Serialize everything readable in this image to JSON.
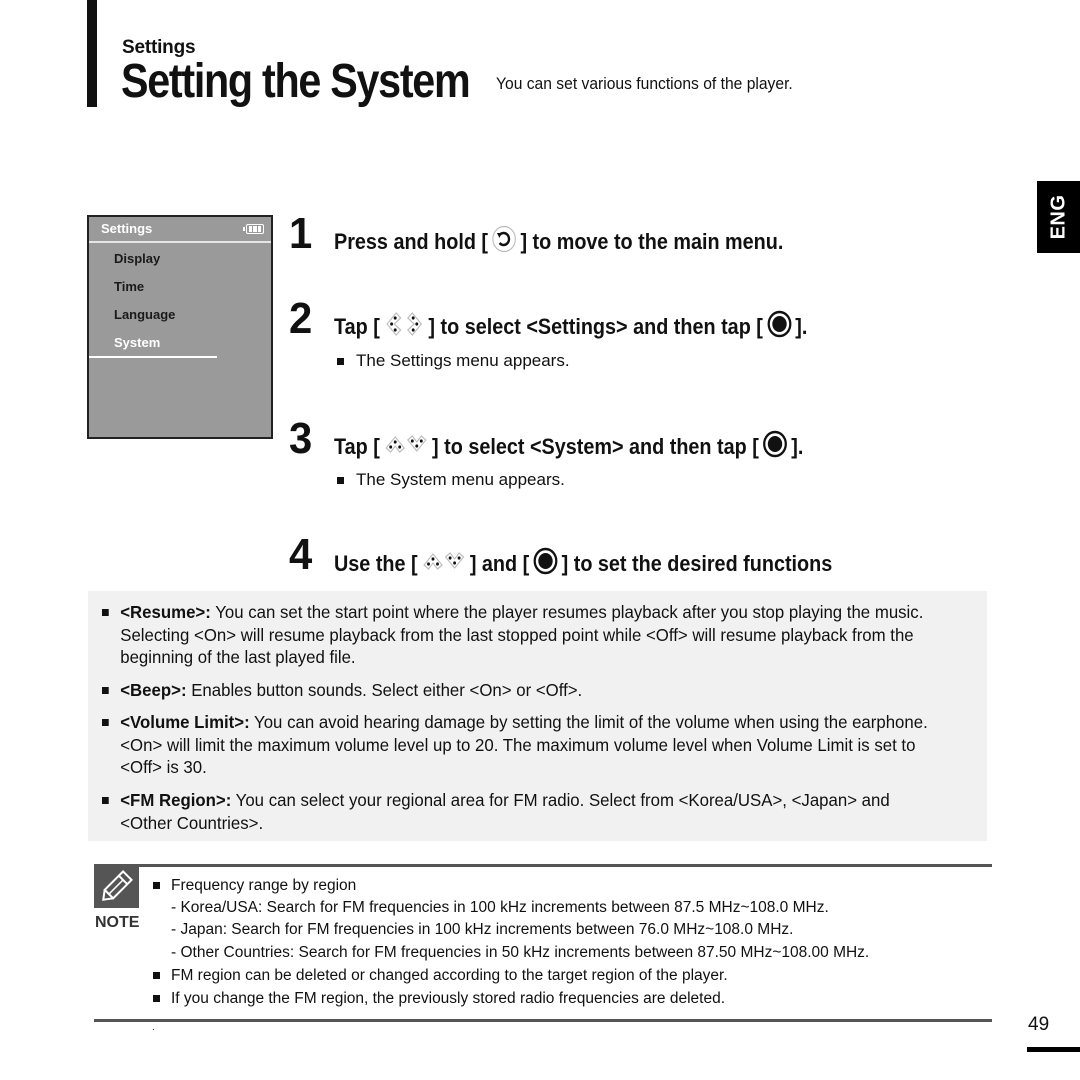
{
  "header": {
    "section": "Settings",
    "title": "Setting the System",
    "subtitle": "You can set various functions of the player."
  },
  "language_tab": "ENG",
  "device_screen": {
    "title": "Settings",
    "battery_icon": "battery-icon",
    "items": [
      {
        "label": "Display",
        "selected": false
      },
      {
        "label": "Time",
        "selected": false
      },
      {
        "label": "Language",
        "selected": false
      },
      {
        "label": "System",
        "selected": true
      }
    ]
  },
  "steps": [
    {
      "number": "1",
      "pre": "Press and hold [",
      "icon1": "back-icon",
      "post": "] to move to the main menu."
    },
    {
      "number": "2",
      "pre": "Tap [",
      "icon1": "left-right-icon",
      "mid": "] to select <Settings> and then tap [",
      "icon2": "select-button-icon",
      "post": "].",
      "note": "The Settings menu appears."
    },
    {
      "number": "3",
      "pre": "Tap [",
      "icon1": "up-down-icon",
      "mid": "] to select <System> and then tap [",
      "icon2": "select-button-icon",
      "post": "].",
      "note": "The System menu appears."
    },
    {
      "number": "4",
      "pre": "Use the [",
      "icon1": "up-down-icon",
      "mid": "] and [",
      "icon2": "select-button-icon",
      "post": "] to set the desired functions"
    }
  ],
  "descriptions": [
    {
      "term": "<Resume>:",
      "text": " You can set the start point where the player resumes playback after you stop playing the music. Selecting <On> will resume playback from the last stopped point while <Off> will resume playback from the beginning of the last played file."
    },
    {
      "term": "<Beep>:",
      "text": " Enables button sounds. Select either <On> or <Off>."
    },
    {
      "term": "<Volume Limit>:",
      "text": " You can avoid hearing damage by setting the limit of the volume when using the earphone. <On> will limit the maximum volume level up to 20. The maximum volume level when Volume Limit is set to <Off> is 30."
    },
    {
      "term": "<FM Region>:",
      "text": " You can select your regional area for FM radio. Select from <Korea/USA>, <Japan> and <Other Countries>."
    }
  ],
  "note": {
    "label": "NOTE",
    "icon": "pencil-icon",
    "lines": [
      {
        "bullet": true,
        "text": "Frequency range by region"
      },
      {
        "bullet": false,
        "text": "- Korea/USA: Search for FM frequencies in 100 kHz increments between 87.5 MHz~108.0 MHz."
      },
      {
        "bullet": false,
        "text": "- Japan: Search for FM frequencies in 100 kHz increments between 76.0 MHz~108.0 MHz."
      },
      {
        "bullet": false,
        "text": "- Other Countries: Search for FM frequencies in 50 kHz increments between 87.50 MHz~108.00 MHz."
      },
      {
        "bullet": true,
        "text": "FM region can be deleted or changed according to the target region of the player."
      },
      {
        "bullet": true,
        "text": "If you change the FM region, the previously stored radio frequencies are deleted."
      }
    ],
    "trailing_dot": "."
  },
  "page_number": "49"
}
